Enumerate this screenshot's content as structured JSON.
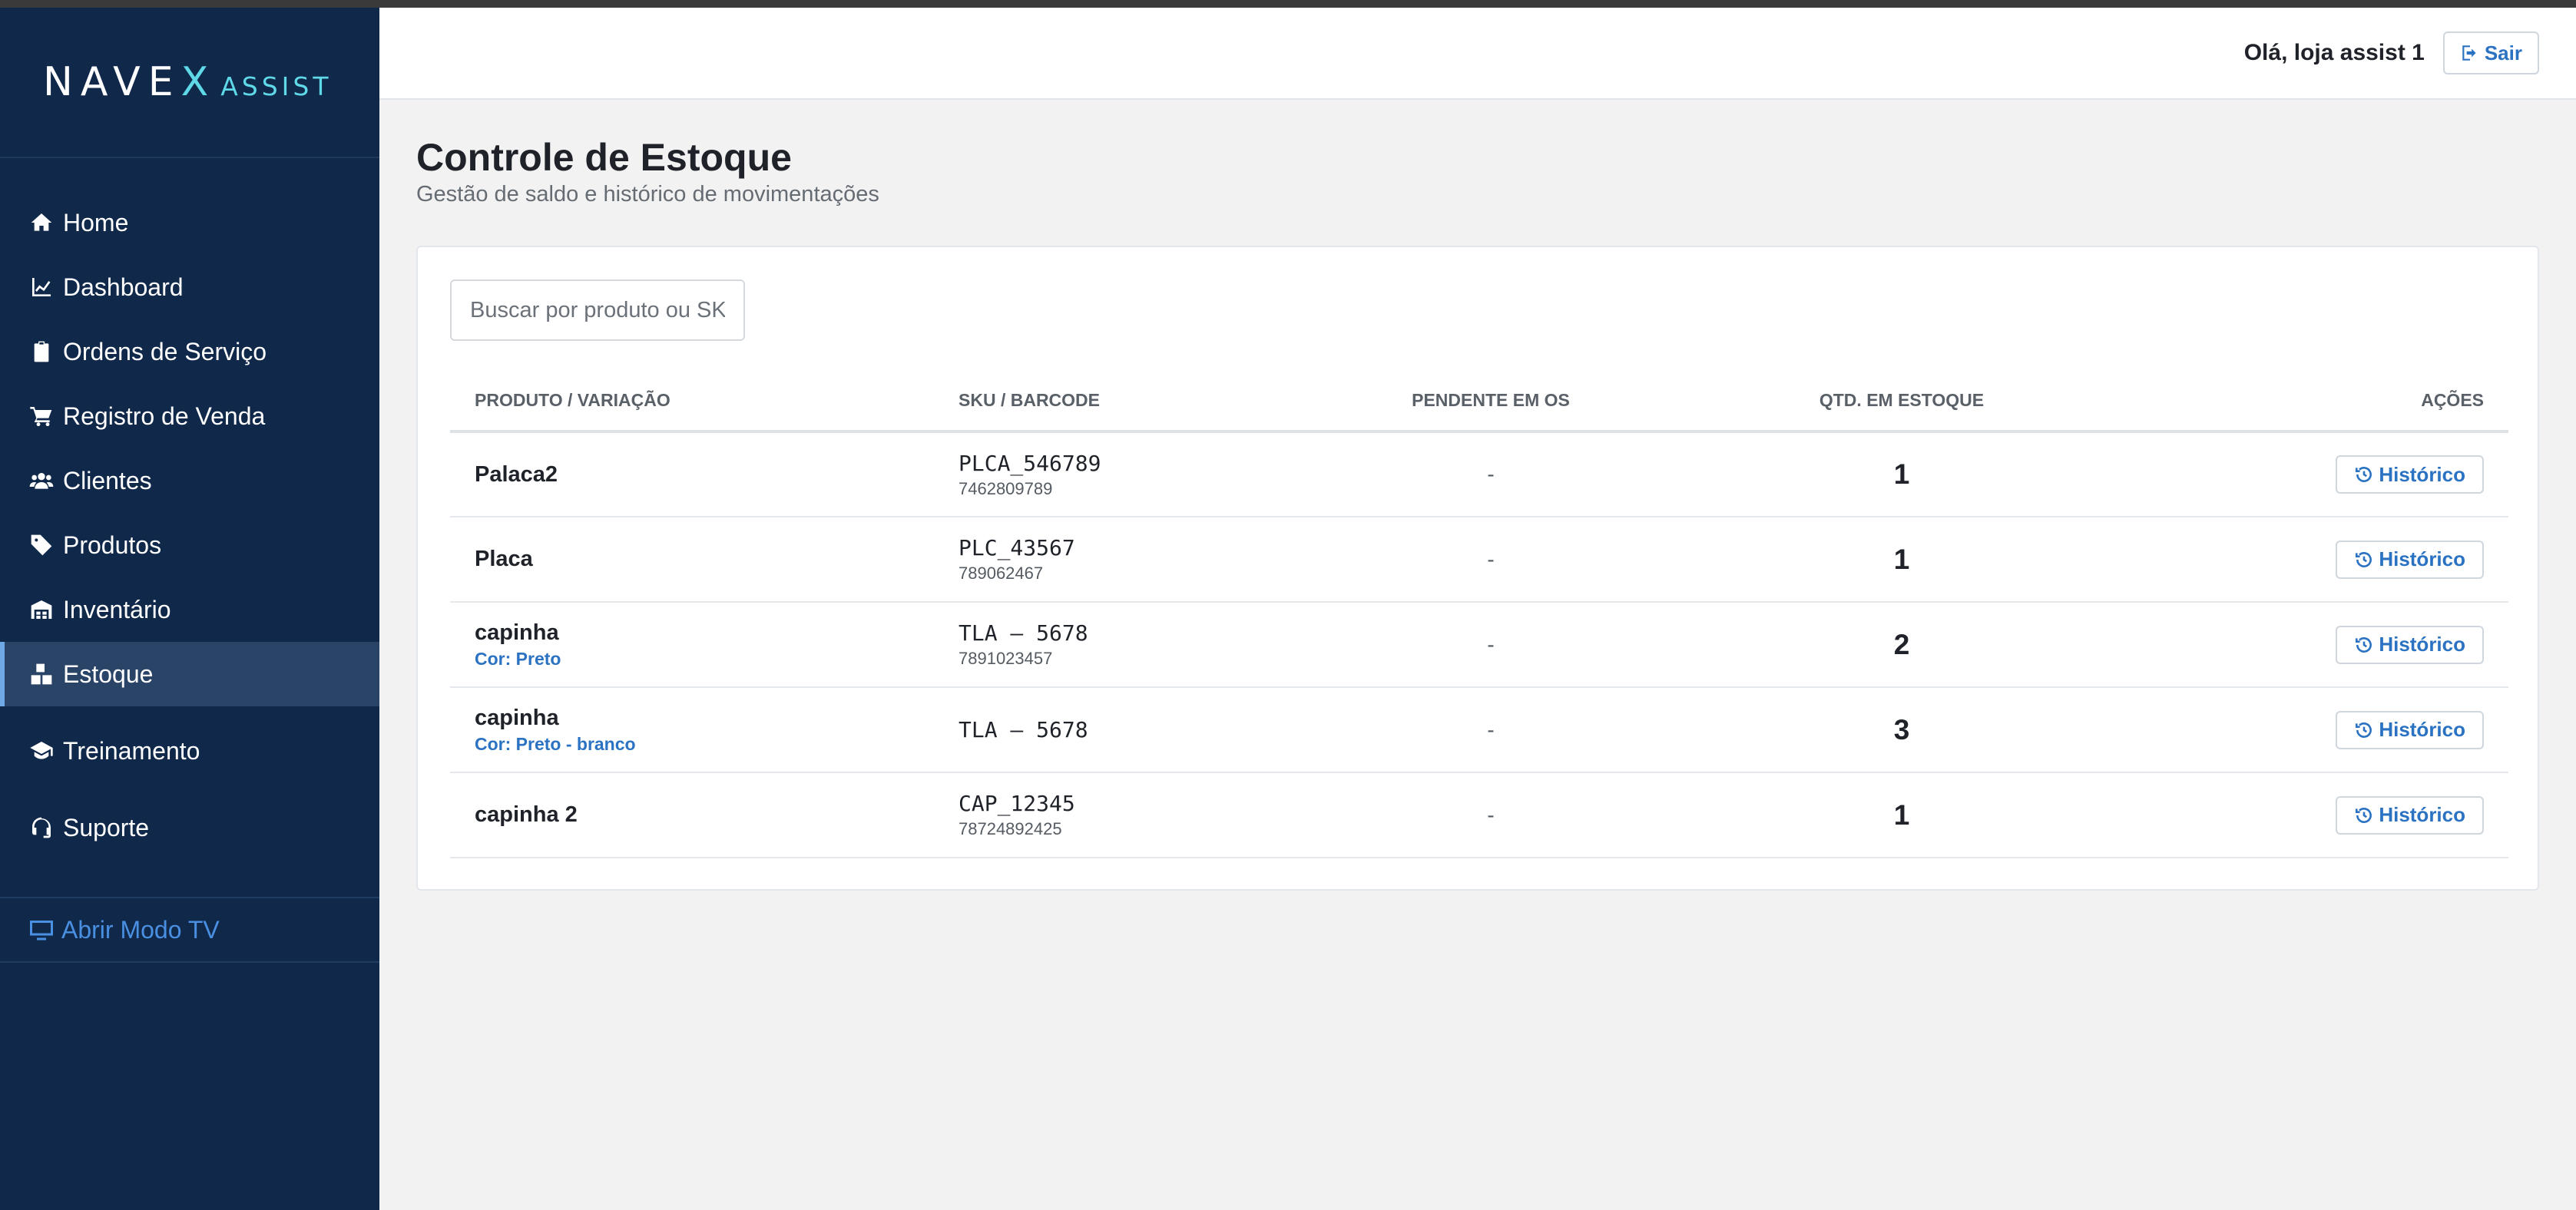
{
  "brand": {
    "name_main": "NAVE",
    "name_x": "X",
    "name_sub": "ASSIST"
  },
  "sidebar": {
    "items": [
      {
        "label": "Home",
        "icon": "home-icon"
      },
      {
        "label": "Dashboard",
        "icon": "chart-line-icon"
      },
      {
        "label": "Ordens de Serviço",
        "icon": "clipboard-icon"
      },
      {
        "label": "Registro de Venda",
        "icon": "cart-icon"
      },
      {
        "label": "Clientes",
        "icon": "users-icon"
      },
      {
        "label": "Produtos",
        "icon": "tag-icon"
      },
      {
        "label": "Inventário",
        "icon": "warehouse-icon"
      },
      {
        "label": "Estoque",
        "icon": "boxes-icon",
        "active": true
      },
      {
        "label": "Treinamento",
        "icon": "graduation-cap-icon"
      },
      {
        "label": "Suporte",
        "icon": "headset-icon"
      }
    ],
    "tv_label": "Abrir Modo TV"
  },
  "header": {
    "greeting": "Olá, loja assist 1",
    "logout_label": "Sair"
  },
  "page": {
    "title": "Controle de Estoque",
    "subtitle": "Gestão de saldo e histórico de movimentações"
  },
  "search": {
    "placeholder": "Buscar por produto ou SKU..."
  },
  "table": {
    "columns": [
      "PRODUTO / VARIAÇÃO",
      "SKU / BARCODE",
      "PENDENTE EM OS",
      "QTD. EM ESTOQUE",
      "AÇÕES"
    ],
    "rows": [
      {
        "product": "Palaca2",
        "variation": "",
        "sku": "PLCA_546789",
        "barcode": "7462809789",
        "pending": "-",
        "qty": "1",
        "action": "Histórico"
      },
      {
        "product": "Placa",
        "variation": "",
        "sku": "PLC_43567",
        "barcode": "789062467",
        "pending": "-",
        "qty": "1",
        "action": "Histórico"
      },
      {
        "product": "capinha",
        "variation": "Cor: Preto",
        "sku": "TLA – 5678",
        "barcode": "7891023457",
        "pending": "-",
        "qty": "2",
        "action": "Histórico"
      },
      {
        "product": "capinha",
        "variation": "Cor: Preto - branco",
        "sku": "TLA – 5678",
        "barcode": "",
        "pending": "-",
        "qty": "3",
        "action": "Histórico"
      },
      {
        "product": "capinha 2",
        "variation": "",
        "sku": "CAP_12345",
        "barcode": "78724892425",
        "pending": "-",
        "qty": "1",
        "action": "Histórico"
      }
    ]
  },
  "colors": {
    "sidebar_bg": "#10284a",
    "accent_cyan": "#5fd8e8",
    "link_blue": "#2b73c2",
    "tv_blue": "#4a90e2",
    "page_bg": "#f2f2f2"
  }
}
